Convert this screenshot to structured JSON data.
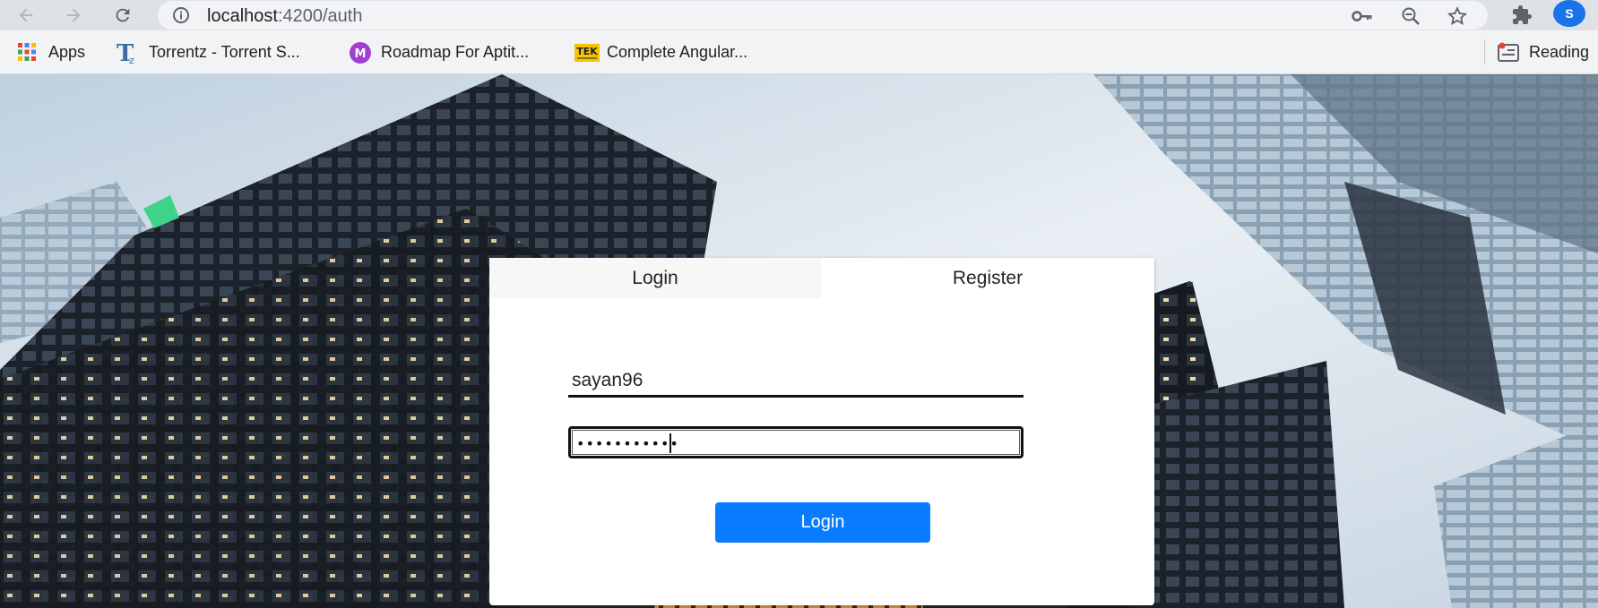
{
  "browser": {
    "url_host": "localhost",
    "url_rest": ":4200/auth",
    "profile_initial": "S"
  },
  "bookmarks": {
    "items": [
      {
        "label": "Apps",
        "icon": "apps-grid-icon"
      },
      {
        "label": "Torrentz - Torrent S...",
        "icon": "torrentz-icon"
      },
      {
        "label": "Roadmap For Aptit...",
        "icon": "m-circle-icon"
      },
      {
        "label": "Complete Angular...",
        "icon": "tek-icon"
      }
    ],
    "tek_text": "TEK",
    "m_text": "M",
    "tz_text": "T",
    "reading_list": "Reading"
  },
  "auth": {
    "tabs": [
      {
        "label": "Login",
        "active": true
      },
      {
        "label": "Register",
        "active": false
      }
    ],
    "username_value": "sayan96",
    "password_mask": "•••••••••••",
    "submit_label": "Login"
  },
  "colors": {
    "primary": "#0a7cff",
    "chrome_toolbar": "#dee1e6",
    "profile": "#1a73e8"
  }
}
